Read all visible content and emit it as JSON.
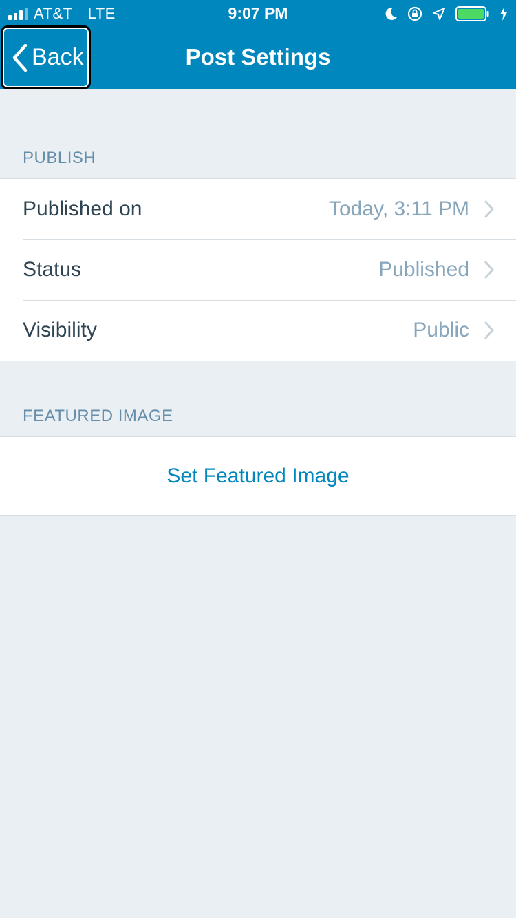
{
  "status_bar": {
    "carrier": "AT&T",
    "network": "LTE",
    "time": "9:07 PM",
    "signal_bars": 4,
    "signal_bars_filled": 3,
    "icons": [
      "moon-icon",
      "rotation-lock-icon",
      "location-arrow-icon",
      "battery-icon",
      "charging-bolt-icon"
    ],
    "battery_color": "#4cd964"
  },
  "nav": {
    "back_label": "Back",
    "title": "Post Settings",
    "bar_color": "#0087be"
  },
  "publish_section": {
    "header": "PUBLISH",
    "rows": [
      {
        "label": "Published on",
        "value": "Today, 3:11 PM"
      },
      {
        "label": "Status",
        "value": "Published"
      },
      {
        "label": "Visibility",
        "value": "Public"
      }
    ]
  },
  "featured_image_section": {
    "header": "FEATURED IMAGE",
    "action_label": "Set Featured Image"
  },
  "colors": {
    "background": "#e9eff3",
    "section_header": "#668eaa",
    "row_label": "#2e4453",
    "row_value": "#87a6bc",
    "action": "#0087be"
  }
}
